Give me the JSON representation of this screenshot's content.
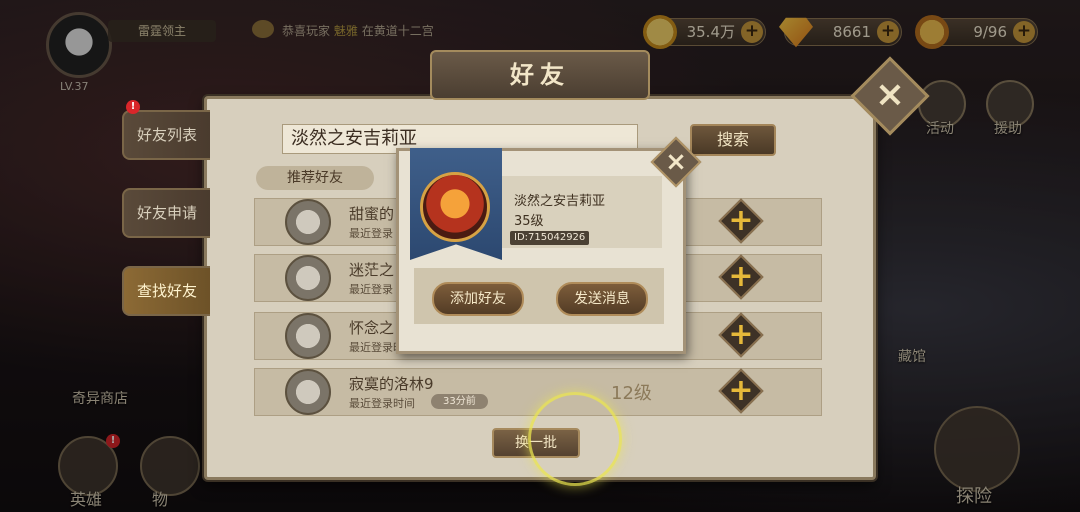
{
  "player": {
    "name": "雷霆领主",
    "level": "LV.37"
  },
  "ticker": {
    "prefix": "恭喜玩家",
    "highlight": "魅雅",
    "suffix": "在黄道十二宫"
  },
  "currencies": [
    {
      "icon": "gold-coin-icon",
      "value": "35.4万",
      "color": "#e4b43a"
    },
    {
      "icon": "diamond-icon",
      "value": "8661",
      "color": "#f09a1c"
    },
    {
      "icon": "stamina-icon",
      "value": "9/96",
      "color": "#e0a03a"
    }
  ],
  "title": "好友",
  "tabs": [
    {
      "label": "好友列表"
    },
    {
      "label": "好友申请"
    },
    {
      "label": "查找好友"
    }
  ],
  "tab_badge": "!",
  "search": {
    "value": "淡然之安吉莉亚",
    "button": "搜索"
  },
  "recommend_label": "推荐好友",
  "friends": [
    {
      "name": "甜蜜的",
      "last_login_label": "最近登录",
      "time": "",
      "level": ""
    },
    {
      "name": "迷茫之",
      "last_login_label": "最近登录",
      "time": "",
      "level": ""
    },
    {
      "name": "怀念之",
      "last_login_label": "最近登录时间",
      "time": "",
      "level": ""
    },
    {
      "name": "寂寞的洛林9",
      "last_login_label": "最近登录时间",
      "time": "33分前",
      "level": "12级"
    }
  ],
  "refresh_button": "换一批",
  "popup": {
    "name": "淡然之安吉莉亚",
    "level": "35级",
    "id": "ID:715042926",
    "add_button": "添加好友",
    "message_button": "发送消息"
  },
  "hud": {
    "activity": "活动",
    "assist": "援助",
    "collection": "藏馆",
    "strange_shop": "奇异商店",
    "hero": "英雄",
    "item": "物",
    "explore": "探险",
    "hero_badge": "!"
  },
  "colors": {
    "panel": "#d7cfbd",
    "accent_gold": "#e6b93a",
    "banner_blue": "#3f5f8a"
  }
}
